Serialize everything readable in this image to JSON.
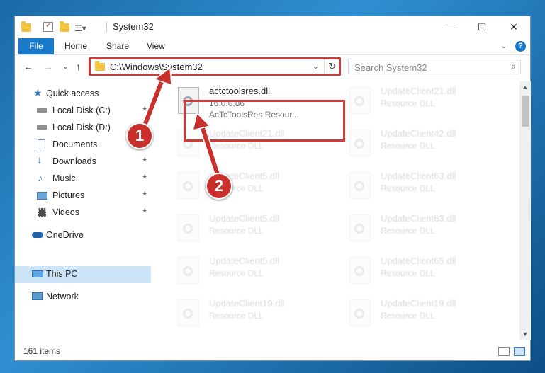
{
  "window": {
    "title": "System32",
    "controls": {
      "minimize": "—",
      "maximize": "☐",
      "close": "✕"
    }
  },
  "ribbon": {
    "file": "File",
    "tabs": [
      "Home",
      "Share",
      "View"
    ],
    "help": "?"
  },
  "nav": {
    "back": "←",
    "forward": "→",
    "recent": "⌄",
    "up": "↑",
    "address": "C:\\Windows\\System32",
    "refresh": "↻",
    "search_placeholder": "Search System32"
  },
  "sidebar": {
    "items": [
      {
        "label": "Quick access",
        "icon": "star-icon"
      },
      {
        "label": "Local Disk (C:)",
        "icon": "drive-icon"
      },
      {
        "label": "Local Disk (D:)",
        "icon": "drive-icon"
      },
      {
        "label": "Documents",
        "icon": "documents-icon"
      },
      {
        "label": "Downloads",
        "icon": "download-icon"
      },
      {
        "label": "Music",
        "icon": "music-icon"
      },
      {
        "label": "Pictures",
        "icon": "pictures-icon"
      },
      {
        "label": "Videos",
        "icon": "videos-icon"
      },
      {
        "label": "OneDrive",
        "icon": "cloud-icon"
      },
      {
        "label": "This PC",
        "icon": "computer-icon"
      },
      {
        "label": "Network",
        "icon": "network-icon"
      }
    ]
  },
  "files": [
    {
      "name": "actctoolsres.dll",
      "line1": "16.0.0.86",
      "line2": "AcTcToolsRes Resour..."
    },
    {
      "name": "UpdateClient21.dll",
      "line1": "Resource DLL"
    },
    {
      "name": "UpdateClient21.dll",
      "line1": "Resource DLL"
    },
    {
      "name": "UpdateClient42.dll",
      "line1": "Resource DLL"
    },
    {
      "name": "UpdateClient5.dll",
      "line1": "Resource DLL"
    },
    {
      "name": "UpdateClient63.dll",
      "line1": "Resource DLL"
    },
    {
      "name": "UpdateClient5.dll",
      "line1": "Resource DLL"
    },
    {
      "name": "UpdateClient63.dll",
      "line1": "Resource DLL"
    },
    {
      "name": "UpdateClient5.dll",
      "line1": "Resource DLL"
    },
    {
      "name": "UpdateClient65.dll",
      "line1": "Resource DLL"
    },
    {
      "name": "UpdateClient19.dll",
      "line1": "Resource DLL"
    },
    {
      "name": "UpdateClient19.dll",
      "line1": "Resource DLL"
    }
  ],
  "status": {
    "items": "161 items"
  },
  "callouts": [
    "1",
    "2"
  ],
  "colors": {
    "accent": "#1979ca",
    "highlight": "#d23a3a",
    "callout": "#c9302c",
    "selected": "#cce4f7"
  }
}
